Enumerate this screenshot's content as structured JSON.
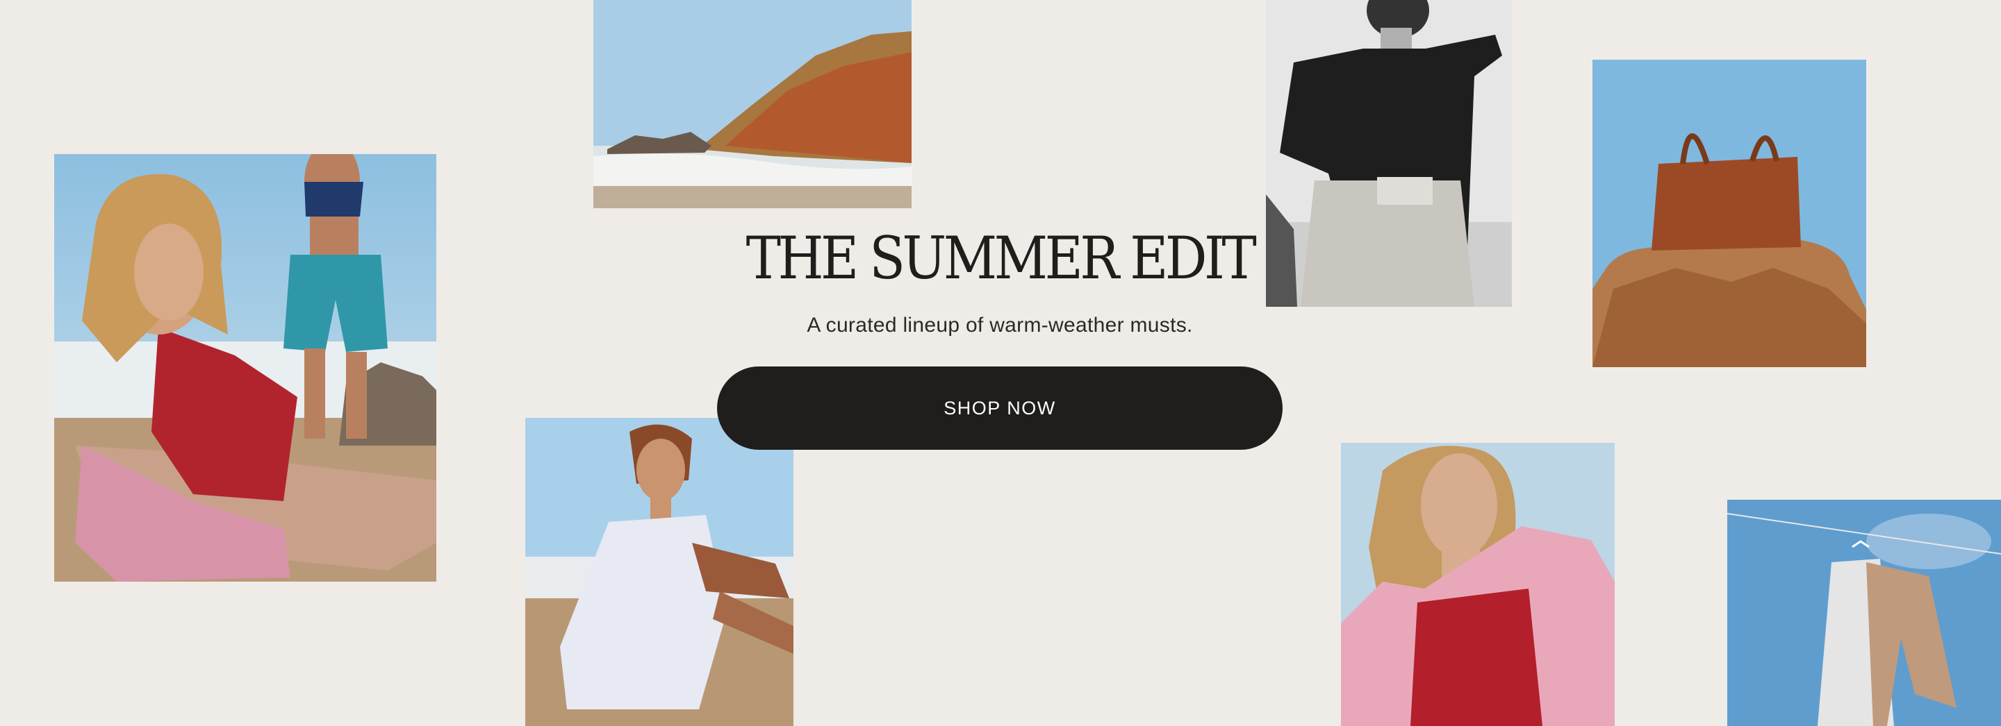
{
  "hero": {
    "title": "THE SUMMER EDIT",
    "subtitle": "A curated lineup of warm-weather musts.",
    "cta_label": "SHOP NOW"
  },
  "colors": {
    "page_background": "#efece8",
    "button_background": "#1f1e1c",
    "button_text": "#ffffff",
    "title_text": "#1f1e1c"
  },
  "collage": [
    {
      "id": "tile-a",
      "name": "photo-beach-red-swimsuit-and-teal-shorts"
    },
    {
      "id": "tile-b",
      "name": "photo-coastal-cliffs"
    },
    {
      "id": "tile-c",
      "name": "photo-woman-white-dress-on-sand"
    },
    {
      "id": "tile-d",
      "name": "photo-black-shirt-linen-shorts"
    },
    {
      "id": "tile-e",
      "name": "photo-woven-leather-tote-on-rock"
    },
    {
      "id": "tile-f",
      "name": "photo-pink-shirt-red-swimsuit"
    },
    {
      "id": "tile-g",
      "name": "photo-garments-on-clothesline"
    }
  ]
}
